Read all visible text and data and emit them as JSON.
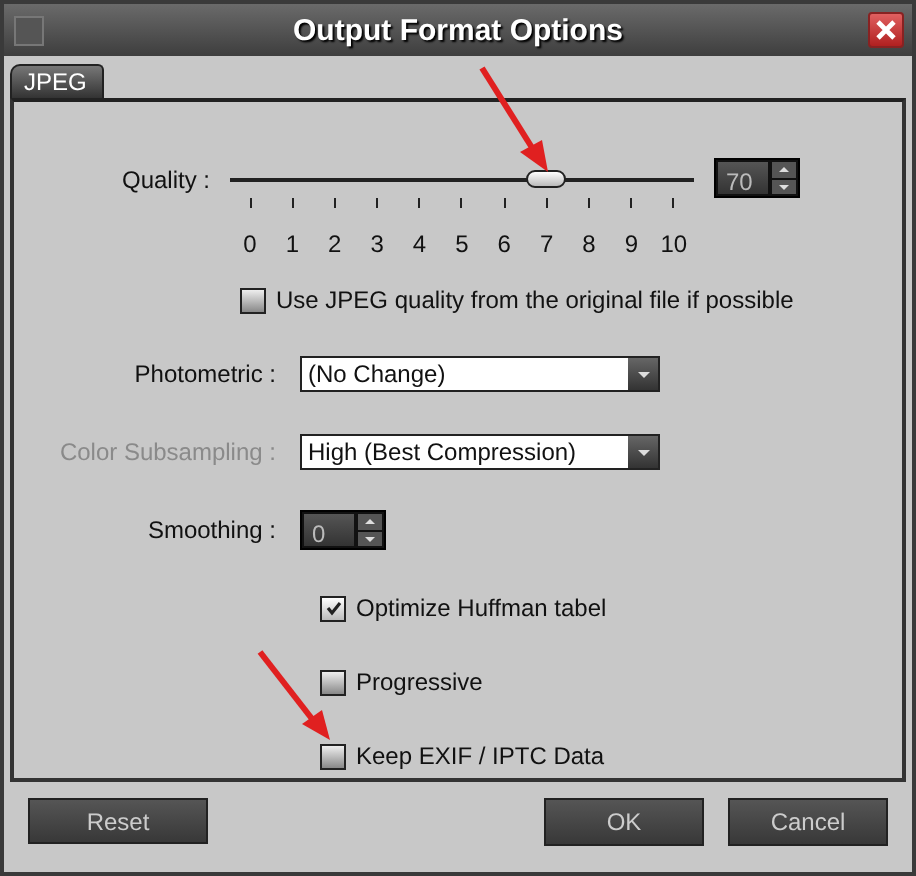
{
  "window": {
    "title": "Output Format Options"
  },
  "tabs": [
    {
      "label": "JPEG",
      "selected": true
    }
  ],
  "quality": {
    "label": "Quality :",
    "level": 0.7,
    "ticks": [
      "0",
      "1",
      "2",
      "3",
      "4",
      "5",
      "6",
      "7",
      "8",
      "9",
      "10"
    ],
    "value": "70"
  },
  "use_original_quality": {
    "label": "Use JPEG quality from the original file if possible",
    "checked": false
  },
  "fields": [
    {
      "kind": "dropdown",
      "label": "Photometric :",
      "value": "(No Change)",
      "disabled": false
    },
    {
      "kind": "dropdown",
      "label": "Color Subsampling :",
      "value": "High (Best Compression)",
      "disabled": true
    },
    {
      "kind": "spinner",
      "label": "Smoothing :",
      "value": "0",
      "disabled": false
    }
  ],
  "options": [
    {
      "label": "Optimize Huffman tabel",
      "checked": true
    },
    {
      "label": "Progressive",
      "checked": false
    },
    {
      "label": "Keep EXIF / IPTC Data",
      "checked": false
    }
  ],
  "buttons": [
    {
      "label": "Reset",
      "kind": "left"
    },
    {
      "label": "OK",
      "kind": "right"
    },
    {
      "label": "Cancel",
      "kind": "right"
    }
  ]
}
